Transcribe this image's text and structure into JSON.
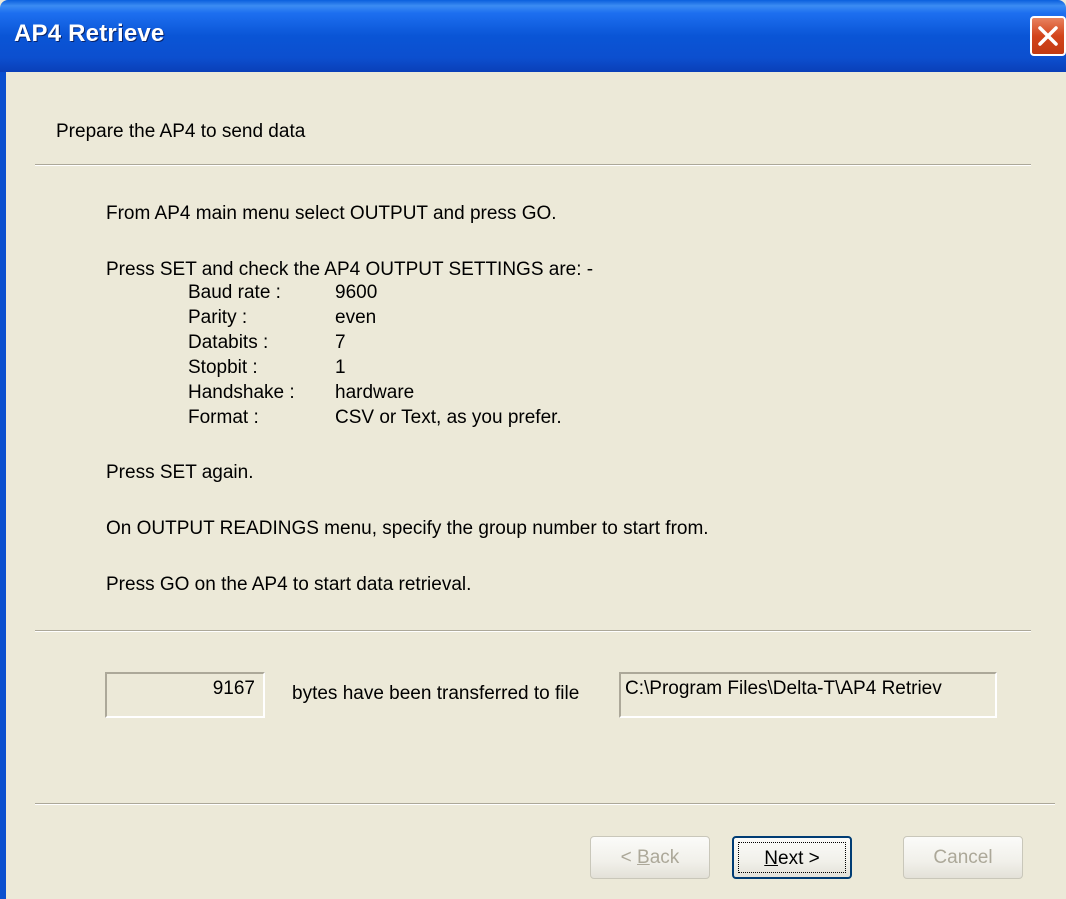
{
  "window": {
    "title": "AP4 Retrieve"
  },
  "header": {
    "subtitle": "Prepare the AP4 to send data"
  },
  "instructions": {
    "step1": "From AP4 main menu select OUTPUT and press GO.",
    "step2": "Press SET and check the AP4 OUTPUT SETTINGS are: -",
    "settings": [
      {
        "label": "Baud rate :",
        "value": "9600"
      },
      {
        "label": "Parity :",
        "value": "even"
      },
      {
        "label": "Databits :",
        "value": "7"
      },
      {
        "label": "Stopbit :",
        "value": "1"
      },
      {
        "label": "Handshake :",
        "value": "hardware"
      },
      {
        "label": "Format :",
        "value": "CSV or Text, as you prefer."
      }
    ],
    "step3": "Press SET again.",
    "step4": "On OUTPUT READINGS menu, specify the group number to start from.",
    "step5": "Press GO on the AP4 to start data retrieval."
  },
  "transfer": {
    "bytes": "9167",
    "label": "bytes have been transferred to file",
    "file_path": "C:\\Program Files\\Delta-T\\AP4 Retriev"
  },
  "buttons": {
    "back": {
      "prefix": "< ",
      "mnemonic": "B",
      "rest": "ack"
    },
    "next": {
      "mnemonic": "N",
      "rest": "ext >"
    },
    "cancel": "Cancel"
  },
  "icons": {
    "close": "close-icon"
  },
  "colors": {
    "titlebar": "#0a55d6",
    "close": "#d3441a",
    "face": "#ece9d8"
  }
}
